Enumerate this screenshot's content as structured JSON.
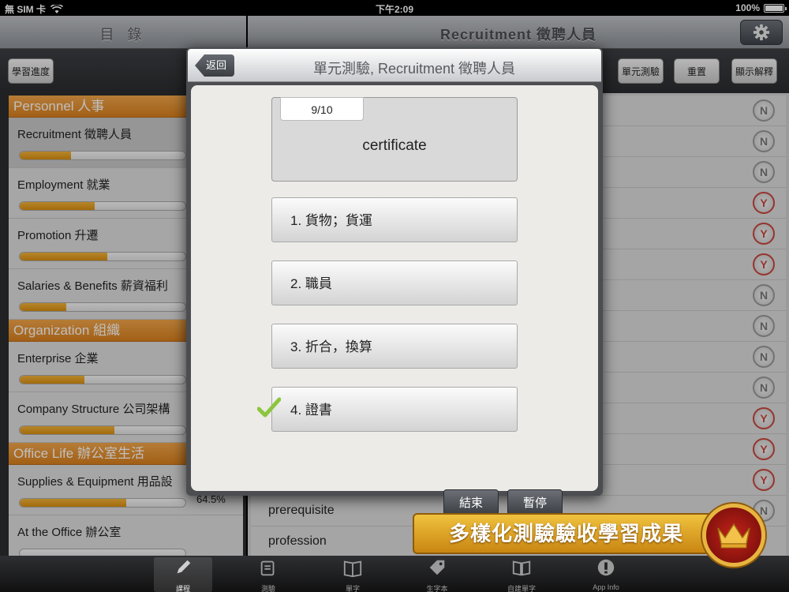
{
  "status_bar": {
    "carrier": "無 SIM 卡",
    "time": "下午2:09",
    "battery": "100%"
  },
  "nav": {
    "left_title": "目 錄",
    "right_title": "Recruitment 徵聘人員"
  },
  "toolbar": {
    "progress_button": "學習進度",
    "unit_test_button": "單元測驗",
    "reset_button": "重置",
    "show_explanation_button": "顯示解釋"
  },
  "sidebar": {
    "sections": [
      {
        "title": "Personnel 人事",
        "items": [
          {
            "label": "Recruitment 徵聘人員",
            "progress": 0.31,
            "percent": "",
            "selected": true
          },
          {
            "label": "Employment 就業",
            "progress": 0.45,
            "percent": ""
          },
          {
            "label": "Promotion 升遷",
            "progress": 0.53,
            "percent": ""
          },
          {
            "label": "Salaries & Benefits 薪資福利",
            "progress": 0.28,
            "percent": ""
          }
        ]
      },
      {
        "title": "Organization 組織",
        "items": [
          {
            "label": "Enterprise 企業",
            "progress": 0.39,
            "percent": ""
          },
          {
            "label": "Company Structure 公司架構",
            "progress": 0.57,
            "percent": ""
          }
        ]
      },
      {
        "title": "Office Life 辦公室生活",
        "items": [
          {
            "label": "Supplies & Equipment 用品設",
            "progress": 0.645,
            "percent": "64.5%"
          },
          {
            "label": "At the Office 辦公室",
            "progress": 0,
            "percent": ""
          }
        ]
      }
    ]
  },
  "main_list": {
    "rows": [
      {
        "word": "",
        "mark": "N"
      },
      {
        "word": "",
        "mark": "N"
      },
      {
        "word": "",
        "mark": "N"
      },
      {
        "word": "",
        "mark": "Y"
      },
      {
        "word": "",
        "mark": "Y"
      },
      {
        "word": "",
        "mark": "Y"
      },
      {
        "word": "",
        "mark": "N"
      },
      {
        "word": "",
        "mark": "N"
      },
      {
        "word": "",
        "mark": "N"
      },
      {
        "word": "",
        "mark": "N"
      },
      {
        "word": "",
        "mark": "Y"
      },
      {
        "word": "",
        "mark": "Y"
      },
      {
        "word": "",
        "mark": "Y"
      },
      {
        "word": "prerequisite",
        "mark": "N"
      },
      {
        "word": "profession",
        "mark": ""
      }
    ]
  },
  "modal": {
    "back_button": "返回",
    "title": "單元測驗, Recruitment 徵聘人員",
    "counter": "9/10",
    "question_word": "certificate",
    "options": [
      {
        "label": "1. 貨物；貨運",
        "correct": false
      },
      {
        "label": "2. 職員",
        "correct": false
      },
      {
        "label": "3. 折合，換算",
        "correct": false
      },
      {
        "label": "4. 證書",
        "correct": true
      }
    ],
    "end_button": "結束",
    "pause_button": "暫停"
  },
  "banner": {
    "text": "多樣化測驗驗收學習成果"
  },
  "tabbar": {
    "tabs": [
      {
        "label": "課程",
        "icon": "pencil-icon",
        "active": true
      },
      {
        "label": "測驗",
        "icon": "quiz-icon",
        "active": false
      },
      {
        "label": "單字",
        "icon": "book-icon",
        "active": false
      },
      {
        "label": "生字本",
        "icon": "tag-icon",
        "active": false
      },
      {
        "label": "自建單字",
        "icon": "edit-book-icon",
        "active": false
      },
      {
        "label": "App Info",
        "icon": "info-icon",
        "active": false
      }
    ]
  },
  "colors": {
    "accent_orange": "#e28c24",
    "progress_fill": "#e39c1c",
    "check_green": "#8cc63f",
    "wrong_red": "#c9463d"
  }
}
